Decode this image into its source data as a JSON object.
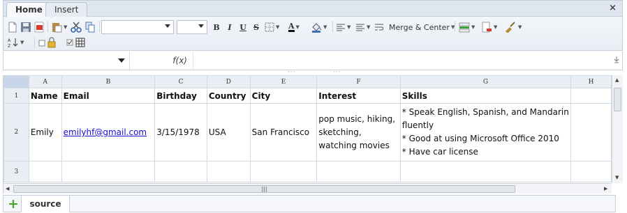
{
  "ribbon": {
    "tabs": [
      "Home",
      "Insert"
    ],
    "close_label": "×",
    "merge_label": "Merge & Center",
    "bold_label": "B",
    "italic_label": "I",
    "underline_label": "U",
    "strike_label": "S",
    "font_color_label": "A"
  },
  "formula_bar": {
    "fx_label": "f(x)",
    "name_value": "",
    "formula_value": ""
  },
  "grid": {
    "columns": [
      "A",
      "B",
      "C",
      "D",
      "E",
      "F",
      "G",
      "H"
    ],
    "rows": [
      {
        "num": "1",
        "cells": [
          "Name",
          "Email",
          "Birthday",
          "Country",
          "City",
          "Interest",
          "Skills",
          ""
        ]
      },
      {
        "num": "2",
        "cells": [
          "Emily",
          "emilyhf@gmail.com",
          "3/15/1978",
          "USA",
          "San Francisco",
          "pop music, hiking, sketching, watching movies",
          "* Speak English, Spanish, and Mandarin fluently\n* Good at using Microsoft Office 2010\n* Have car license",
          ""
        ]
      },
      {
        "num": "3",
        "cells": [
          "",
          "",
          "",
          "",
          "",
          "",
          "",
          ""
        ]
      }
    ]
  },
  "sheets": {
    "add_label": "+",
    "tabs": [
      "source"
    ]
  },
  "colors": {
    "accent": "#4aa32c",
    "link": "#1a0dcc",
    "header_bg": "#e9eef5",
    "corner_bg": "#c7d6e8"
  }
}
